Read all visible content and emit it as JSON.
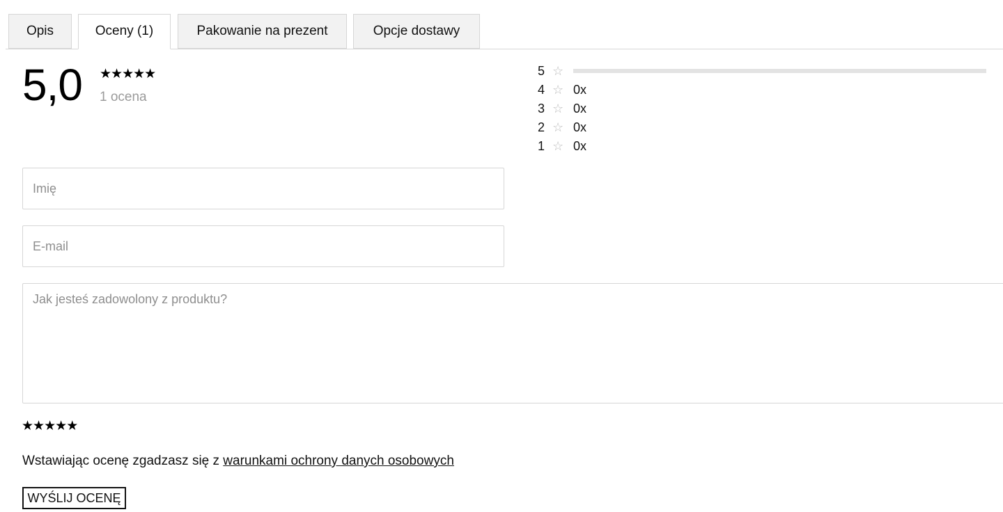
{
  "tabs": [
    {
      "label": "Opis",
      "active": false
    },
    {
      "label": "Oceny (1)",
      "active": true
    },
    {
      "label": "Pakowanie na prezent",
      "active": false
    },
    {
      "label": "Opcje dostawy",
      "active": false
    }
  ],
  "rating": {
    "score": "5,0",
    "stars": "★★★★★",
    "count_label": "1 ocena"
  },
  "distribution": [
    {
      "stars": "5",
      "star_icon": "☆",
      "fraction": 1.0,
      "label": ""
    },
    {
      "stars": "4",
      "star_icon": "☆",
      "fraction": 0,
      "label": "0x"
    },
    {
      "stars": "3",
      "star_icon": "☆",
      "fraction": 0,
      "label": "0x"
    },
    {
      "stars": "2",
      "star_icon": "☆",
      "fraction": 0,
      "label": "0x"
    },
    {
      "stars": "1",
      "star_icon": "☆",
      "fraction": 0,
      "label": "0x"
    }
  ],
  "form": {
    "name_placeholder": "Imię",
    "email_placeholder": "E-mail",
    "review_placeholder": "Jak jesteś zadowolony z produktu?",
    "star_input": "★",
    "consent_text": "Wstawiając ocenę zgadzasz się z ",
    "consent_link": "warunkami ochrony danych osobowych",
    "submit_label": "WYŚLIJ OCENĘ"
  },
  "colors": {
    "accent": "#111111",
    "muted": "#9a9a9a",
    "bar": "#e3e3e3",
    "border": "#d6d6d6"
  }
}
